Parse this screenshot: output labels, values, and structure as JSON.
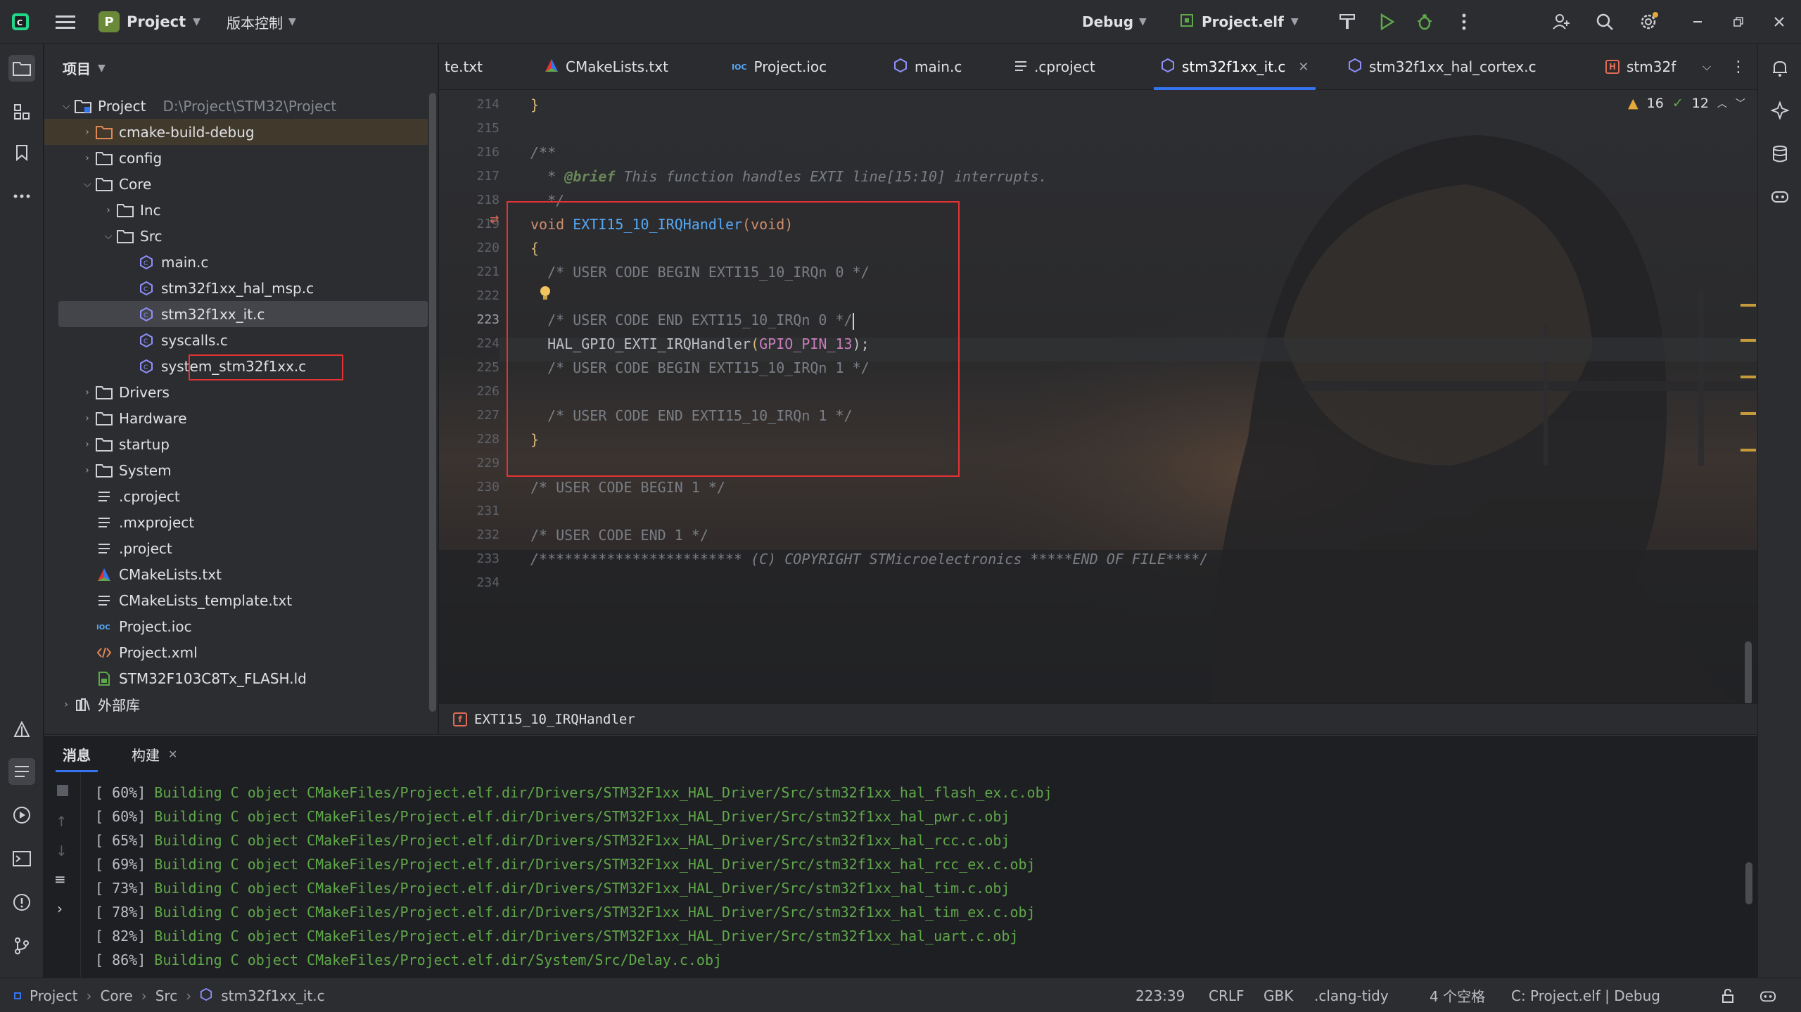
{
  "titlebar": {
    "project_badge": "P",
    "project_name": "Project",
    "vcs_label": "版本控制",
    "run_config": "Debug",
    "target_config": "Project.elf"
  },
  "project_panel": {
    "header": "项目",
    "tree": [
      {
        "label": "Project",
        "hint": "D:\\Project\\STM32\\Project",
        "icon": "module-folder-icon"
      },
      {
        "label": "cmake-build-debug",
        "icon": "excluded-folder-icon"
      },
      {
        "label": "config",
        "icon": "folder-icon"
      },
      {
        "label": "Core",
        "icon": "folder-icon"
      },
      {
        "label": "Inc",
        "icon": "folder-icon"
      },
      {
        "label": "Src",
        "icon": "folder-icon"
      },
      {
        "label": "main.c",
        "icon": "c-file-icon"
      },
      {
        "label": "stm32f1xx_hal_msp.c",
        "icon": "c-file-icon"
      },
      {
        "label": "stm32f1xx_it.c",
        "icon": "c-file-icon"
      },
      {
        "label": "syscalls.c",
        "icon": "c-file-icon"
      },
      {
        "label": "system_stm32f1xx.c",
        "icon": "c-file-icon"
      },
      {
        "label": "Drivers",
        "icon": "folder-icon"
      },
      {
        "label": "Hardware",
        "icon": "folder-icon"
      },
      {
        "label": "startup",
        "icon": "folder-icon"
      },
      {
        "label": "System",
        "icon": "folder-icon"
      },
      {
        "label": ".cproject",
        "icon": "text-file-icon"
      },
      {
        "label": ".mxproject",
        "icon": "text-file-icon"
      },
      {
        "label": ".project",
        "icon": "text-file-icon"
      },
      {
        "label": "CMakeLists.txt",
        "icon": "cmake-icon"
      },
      {
        "label": "CMakeLists_template.txt",
        "icon": "text-file-icon"
      },
      {
        "label": "Project.ioc",
        "icon": "ioc-file-icon"
      },
      {
        "label": "Project.xml",
        "icon": "xml-file-icon"
      },
      {
        "label": "STM32F103C8Tx_FLASH.ld",
        "icon": "ld-file-icon"
      },
      {
        "label": "外部库",
        "icon": "library-icon"
      }
    ]
  },
  "tabs": [
    {
      "label": "te.txt"
    },
    {
      "label": "CMakeLists.txt"
    },
    {
      "label": "Project.ioc"
    },
    {
      "label": "main.c"
    },
    {
      "label": ".cproject"
    },
    {
      "label": "stm32f1xx_it.c"
    },
    {
      "label": "stm32f1xx_hal_cortex.c"
    },
    {
      "label": "stm32f"
    }
  ],
  "editor": {
    "line_numbers": [
      "214",
      "215",
      "216",
      "217",
      "218",
      "219",
      "220",
      "221",
      "222",
      "223",
      "224",
      "225",
      "226",
      "227",
      "228",
      "229",
      "230",
      "231",
      "232",
      "233",
      "234"
    ],
    "current_line": "223",
    "warnings": "16",
    "checks": "12",
    "lines": {
      "l214": "}",
      "l216": "/**",
      "l217a": "  * ",
      "l217b": "@brief",
      "l217c": " This function handles EXTI line[15:10] interrupts.",
      "l218": "  */",
      "l219a": "void",
      "l219b": " EXTI15_10_IRQHandler",
      "l219c": "(void)",
      "l220": "{",
      "l221": "  /* USER CODE BEGIN EXTI15_10_IRQn 0 */",
      "l223": "  /* USER CODE END EXTI15_10_IRQn 0 */",
      "l224a": "  HAL_GPIO_EXTI_IRQHandler",
      "l224b": "(",
      "l224c": "GPIO_PIN_13",
      "l224d": ");",
      "l225": "  /* USER CODE BEGIN EXTI15_10_IRQn 1 */",
      "l227": "  /* USER CODE END EXTI15_10_IRQn 1 */",
      "l228": "}",
      "l230": "/* USER CODE BEGIN 1 */",
      "l232": "/* USER CODE END 1 */",
      "l233": "/************************ (C) COPYRIGHT STMicroelectronics *****END OF FILE****/"
    },
    "breadcrumb_fn": "EXTI15_10_IRQHandler"
  },
  "bottom_panel": {
    "tab_messages": "消息",
    "tab_build": "构建",
    "log": [
      {
        "pct": "[ 60%]",
        "msg": "Building C object CMakeFiles/Project.elf.dir/Drivers/STM32F1xx_HAL_Driver/Src/stm32f1xx_hal_flash_ex.c.obj"
      },
      {
        "pct": "[ 60%]",
        "msg": "Building C object CMakeFiles/Project.elf.dir/Drivers/STM32F1xx_HAL_Driver/Src/stm32f1xx_hal_pwr.c.obj"
      },
      {
        "pct": "[ 65%]",
        "msg": "Building C object CMakeFiles/Project.elf.dir/Drivers/STM32F1xx_HAL_Driver/Src/stm32f1xx_hal_rcc.c.obj"
      },
      {
        "pct": "[ 69%]",
        "msg": "Building C object CMakeFiles/Project.elf.dir/Drivers/STM32F1xx_HAL_Driver/Src/stm32f1xx_hal_rcc_ex.c.obj"
      },
      {
        "pct": "[ 73%]",
        "msg": "Building C object CMakeFiles/Project.elf.dir/Drivers/STM32F1xx_HAL_Driver/Src/stm32f1xx_hal_tim.c.obj"
      },
      {
        "pct": "[ 78%]",
        "msg": "Building C object CMakeFiles/Project.elf.dir/Drivers/STM32F1xx_HAL_Driver/Src/stm32f1xx_hal_tim_ex.c.obj"
      },
      {
        "pct": "[ 82%]",
        "msg": "Building C object CMakeFiles/Project.elf.dir/Drivers/STM32F1xx_HAL_Driver/Src/stm32f1xx_hal_uart.c.obj"
      },
      {
        "pct": "[ 86%]",
        "msg": "Building C object CMakeFiles/Project.elf.dir/System/Src/Delay.c.obj"
      }
    ]
  },
  "statusbar": {
    "crumbs": [
      "Project",
      "Core",
      "Src",
      "stm32f1xx_it.c"
    ],
    "caret": "223:39",
    "line_sep": "CRLF",
    "encoding": "GBK",
    "linter": ".clang-tidy",
    "indent": "4 个空格",
    "context": "C: Project.elf | Debug"
  },
  "colors": {
    "accent": "#3574f0",
    "highlight_box": "#e33333",
    "build_green": "#5fa84a"
  }
}
